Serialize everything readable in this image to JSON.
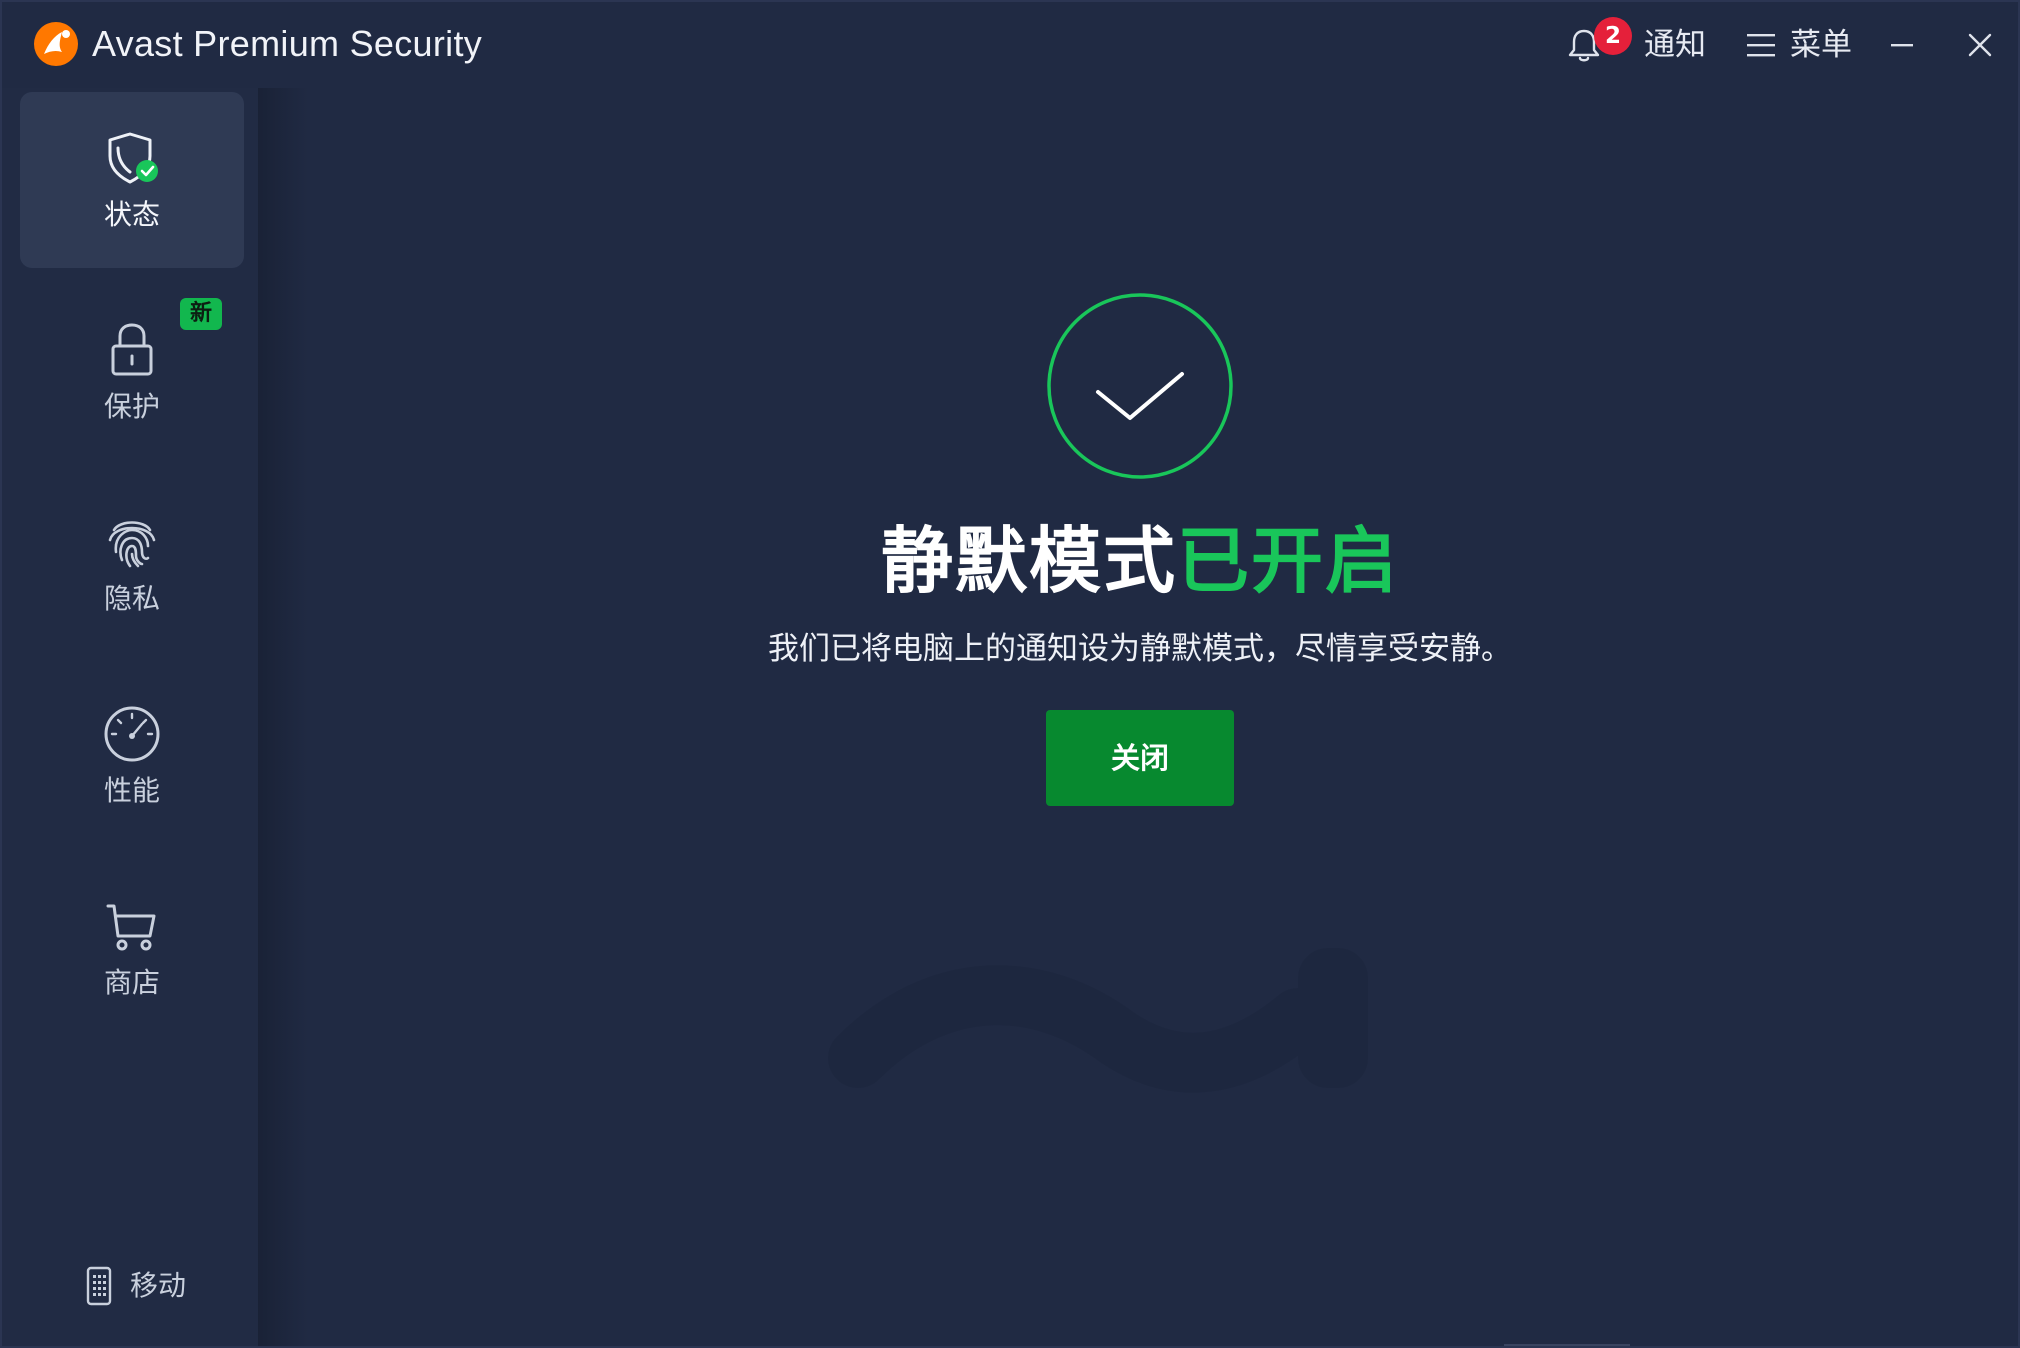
{
  "window": {
    "title": "Avast Premium Security"
  },
  "header": {
    "notifications_label": "通知",
    "notifications_count": "2",
    "menu_label": "菜单"
  },
  "sidebar": {
    "items": [
      {
        "label": "状态",
        "icon": "shield-check-icon",
        "active": true
      },
      {
        "label": "保护",
        "icon": "lock-icon",
        "badge": "新"
      },
      {
        "label": "隐私",
        "icon": "fingerprint-icon"
      },
      {
        "label": "性能",
        "icon": "speedometer-icon"
      },
      {
        "label": "商店",
        "icon": "cart-icon"
      }
    ],
    "mobile_label": "移动"
  },
  "main": {
    "headline_part1": "静默模式",
    "headline_part2": "已开启",
    "subtitle": "我们已将电脑上的通知设为静默模式，尽情享受安静。",
    "close_button": "关闭"
  },
  "colors": {
    "background": "#202a43",
    "accent_green": "#19c65a",
    "button_green": "#07892f",
    "badge_red": "#e5203a",
    "brand_orange": "#ff7800"
  }
}
